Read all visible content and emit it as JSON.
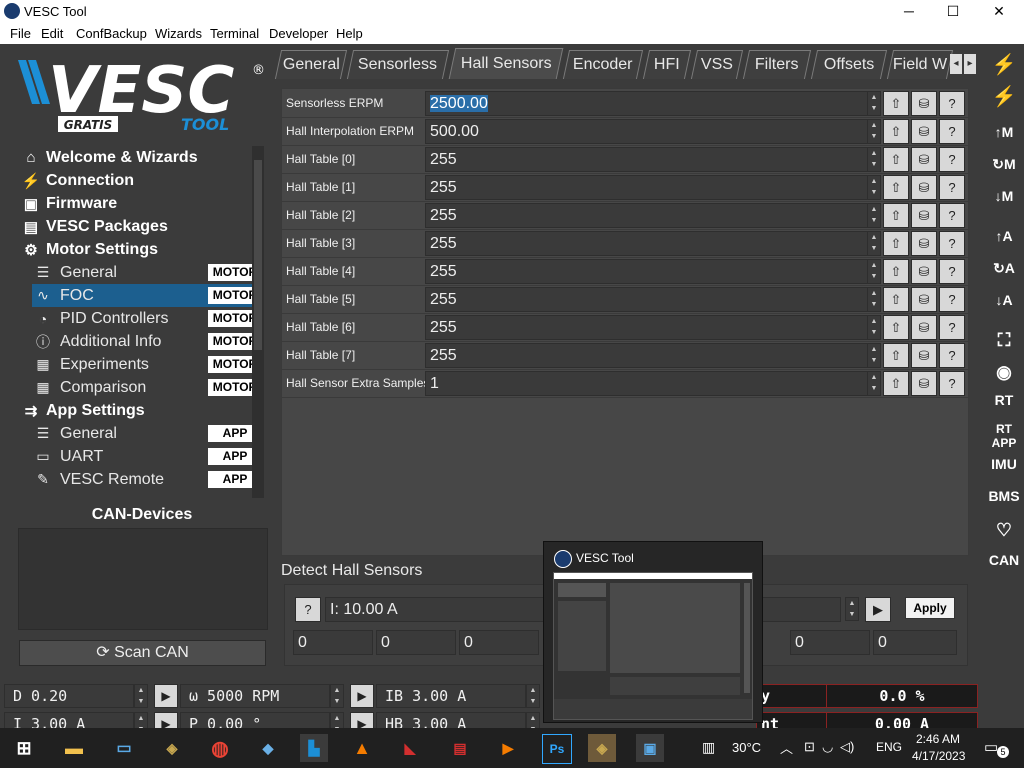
{
  "window": {
    "title": "VESC Tool",
    "min": "─",
    "max": "☐",
    "close": "✕"
  },
  "menu": [
    "File",
    "Edit",
    "ConfBackup",
    "Wizards",
    "Terminal",
    "Developer",
    "Help"
  ],
  "logo": {
    "brand": "VESC",
    "gratis": "GRATIS",
    "tool": "TOOL",
    "reg": "®"
  },
  "sidebar": {
    "welcome": "Welcome & Wizards",
    "connection": "Connection",
    "firmware": "Firmware",
    "packages": "VESC Packages",
    "motor_settings": "Motor Settings",
    "motor_items": [
      {
        "label": "General",
        "tag": "MOTOR"
      },
      {
        "label": "FOC",
        "tag": "MOTOR"
      },
      {
        "label": "PID Controllers",
        "tag": "MOTOR"
      },
      {
        "label": "Additional Info",
        "tag": "MOTOR"
      },
      {
        "label": "Experiments",
        "tag": "MOTOR"
      },
      {
        "label": "Comparison",
        "tag": "MOTOR"
      }
    ],
    "app_settings": "App Settings",
    "app_items": [
      {
        "label": "General",
        "tag": "APP"
      },
      {
        "label": "UART",
        "tag": "APP"
      },
      {
        "label": "VESC Remote",
        "tag": "APP"
      }
    ]
  },
  "can": {
    "title": "CAN-Devices",
    "scan": "Scan CAN"
  },
  "tabs": [
    "General",
    "Sensorless",
    "Hall Sensors",
    "Encoder",
    "HFI",
    "VSS",
    "Filters",
    "Offsets",
    "Field W"
  ],
  "selected_tab": "Hall Sensors",
  "params": [
    {
      "label": "Sensorless ERPM",
      "value": "2500.00"
    },
    {
      "label": "Hall Interpolation ERPM",
      "value": "500.00"
    },
    {
      "label": "Hall Table [0]",
      "value": "255"
    },
    {
      "label": "Hall Table [1]",
      "value": "255"
    },
    {
      "label": "Hall Table [2]",
      "value": "255"
    },
    {
      "label": "Hall Table [3]",
      "value": "255"
    },
    {
      "label": "Hall Table [4]",
      "value": "255"
    },
    {
      "label": "Hall Table [5]",
      "value": "255"
    },
    {
      "label": "Hall Table [6]",
      "value": "255"
    },
    {
      "label": "Hall Table [7]",
      "value": "255"
    },
    {
      "label": "Hall Sensor Extra Samples",
      "value": "1"
    }
  ],
  "detect": {
    "title": "Detect Hall Sensors",
    "current": "I: 10.00 A",
    "apply": "Apply",
    "results": [
      "0",
      "0",
      "0",
      "0",
      "0"
    ]
  },
  "rtool": [
    "↑M",
    "↻M",
    "↓M",
    "↑A",
    "↻A",
    "↓A",
    "RT",
    "RT APP",
    "IMU",
    "BMS",
    "♡",
    "CAN"
  ],
  "status": {
    "duty": "D 0.20",
    "rpm": "ω 5000 RPM",
    "ib": "IB 3.00 A",
    "current": "I 3.00 A",
    "pos": "P 0.00 °",
    "hb": "HB 3.00 A",
    "duty_label": "y",
    "duty_reading": "0.0 %",
    "current_label": "nt",
    "current_reading": "0.00 A"
  },
  "popup": {
    "title": "VESC Tool"
  },
  "taskbar": {
    "temp": "30°C",
    "lang": "ENG",
    "time": "2:46 AM",
    "date": "4/17/2023",
    "notif": "5"
  }
}
